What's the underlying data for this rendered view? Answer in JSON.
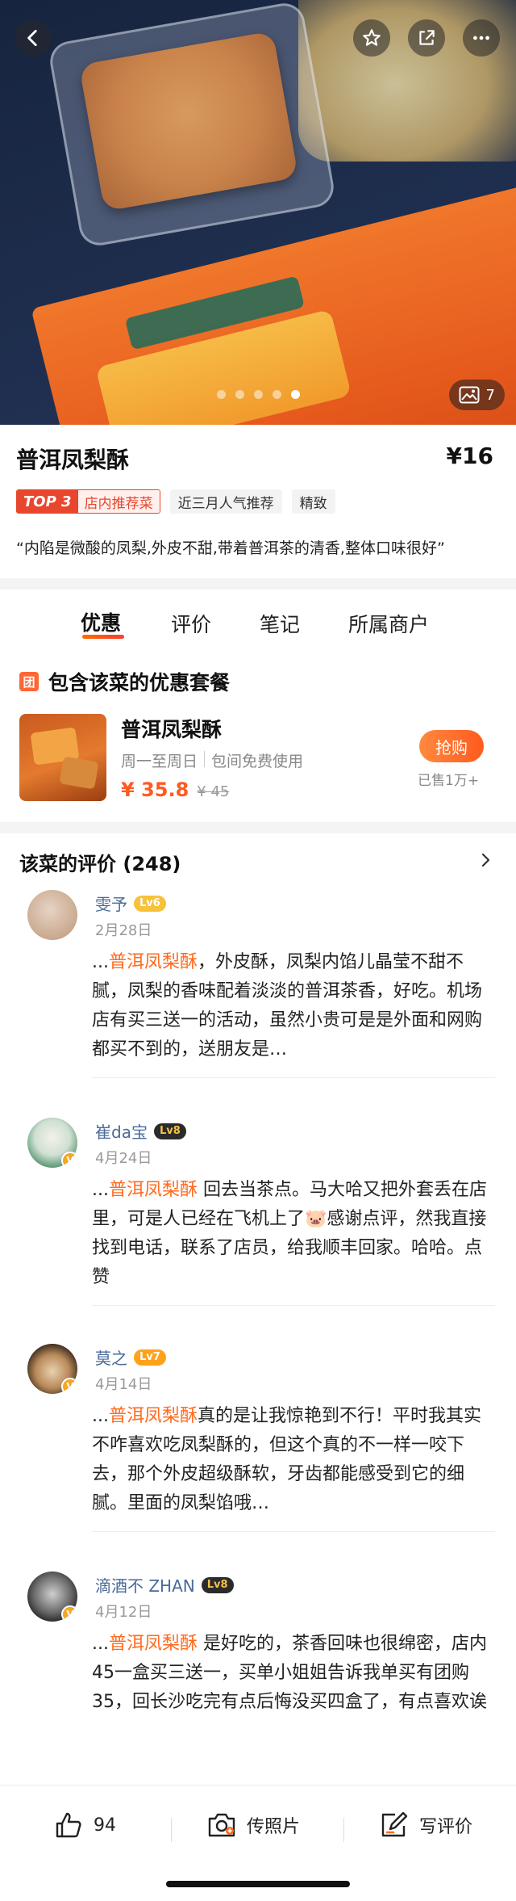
{
  "hero": {
    "photo_count": "7",
    "dots_total": 5,
    "dots_active": 5
  },
  "dish": {
    "name": "普洱凤梨酥",
    "price": "¥16",
    "top_label": "TOP 3",
    "top_text": "店内推荐菜",
    "tag1": "近三月人气推荐",
    "tag2": "精致",
    "quote": "“内陷是微酸的凤梨,外皮不甜,带着普洱茶的清香,整体口味很好”"
  },
  "tabs": [
    "优惠",
    "评价",
    "笔记",
    "所属商户"
  ],
  "deal": {
    "section_icon": "团",
    "section_title": "包含该菜的优惠套餐",
    "name": "普洱凤梨酥",
    "days": "周一至周日",
    "room": "包间免费使用",
    "price_now": "¥ 35.8",
    "price_old": "¥ 45",
    "buy_label": "抢购",
    "sold": "已售1万+"
  },
  "reviews_header": "该菜的评价 (248)",
  "reviews": [
    {
      "user": "雯予",
      "level": "Lv6",
      "date": "2月28日",
      "prefix": "...",
      "dish": "普洱凤梨酥",
      "text": "，外皮酥，凤梨内馅儿晶莹不甜不腻，凤梨的香味配着淡淡的普洱茶香，好吃。机场店有买三送一的活动，虽然小贵可是是外面和网购都买不到的，送朋友是…"
    },
    {
      "user": "崔da宝",
      "level": "Lv8",
      "date": "4月24日",
      "prefix": "...",
      "dish": "普洱凤梨酥",
      "text": " 回去当茶点。马大哈又把外套丢在店里，可是人已经在飞机上了🐷感谢点评，然我直接找到电话，联系了店员，给我顺丰回家。哈哈。点赞"
    },
    {
      "user": "莫之",
      "level": "Lv7",
      "date": "4月14日",
      "prefix": "...",
      "dish": "普洱凤梨酥",
      "text": "真的是让我惊艳到不行！平时我其实不咋喜欢吃凤梨酥的，但这个真的不一样一咬下去，那个外皮超级酥软，牙齿都能感受到它的细腻。里面的凤梨馅哦…"
    },
    {
      "user": "滴酒不 ZHAN",
      "level": "Lv8",
      "date": "4月12日",
      "prefix": "...",
      "dish": "普洱凤梨酥",
      "text": " 是好吃的，茶香回味也很绵密，店内45一盒买三送一，买单小姐姐告诉我单买有团购35，回长沙吃完有点后悔没买四盒了，有点喜欢诶"
    }
  ],
  "bottom": {
    "like_count": "94",
    "photo_label": "传照片",
    "review_label": "写评价"
  },
  "colors": {
    "accent": "#ff5a1f",
    "link": "#4a6a99"
  }
}
